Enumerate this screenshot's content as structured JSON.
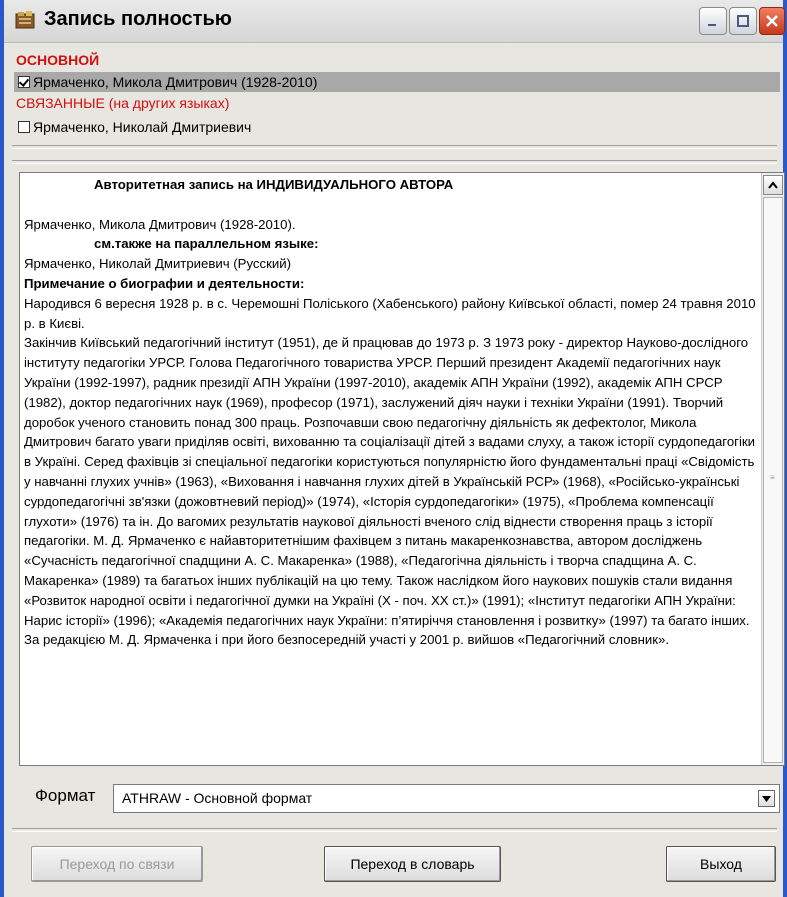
{
  "window": {
    "title": "Запись полностью",
    "controls": [
      "minimize-icon",
      "maximize-icon",
      "close-icon"
    ]
  },
  "main_heading": "ОСНОВНОЙ",
  "main_record": "Ярмаченко, Микола Дмитрович (1928-2010)",
  "related_heading": "СВЯЗАННЫЕ (на других языках)",
  "related_record": "Ярмаченко, Николай Дмитриевич",
  "record_text": {
    "title": "Авторитетная запись на ИНДИВИДУАЛЬНОГО АВТОРА",
    "name": "Ярмаченко, Микола Дмитрович (1928-2010).",
    "see_also": "см.также на параллельном языке:",
    "parallel": "Ярмаченко, Николай Дмитриевич (Русский)",
    "note_heading": "Примечание о биографии и деятельности:",
    "born": "Народився 6 вересня 1928 р. в с. Черемошні Поліського (Хабенського) району Київської області, помер  24 травня 2010 р. в Києві.",
    "bio": "Закінчив Київський педагогічний інститут (1951), де й працював до 1973 р. З 1973 року - директор Науково-дослідного інституту педагогіки УРСР. Голова Педагогічного товариства УРСР. Перший президент Академії педагогічних наук України (1992-1997), радник президії АПН України (1997-2010), академік АПН України (1992), академік АПН СРСР (1982), доктор педагогічних наук (1969), професор (1971), заслужений діяч науки і техніки України (1991). Творчий доробок ученого становить понад 300 праць. Розпочавши свою педагогічну діяльність як дефектолог, Микола Дмитрович багато уваги приділяв освіті, вихованню та соціалізації дітей з вадами слуху, а також історії сурдопедагогіки в Україні. Серед фахівців зі спеціальної педагогіки користуються популярністю його фундаментальні праці «Свідомість у навчанні глухих учнів» (1963), «Виховання і навчання глухих дітей в Українській РСР» (1968), «Російсько-українські сурдопедагогічні зв'язки (дожовтневий період)» (1974), «Історія сурдопедагогіки» (1975), «Проблема компенсації глухоти» (1976) та ін. До вагомих результатів наукової діяльності вченого слід віднести створення праць з історії педагогіки. М. Д. Ярмаченко є найавторитетнішим фахівцем з питань макаренкознавства, автором досліджень «Сучасність педагогічної спадщини А. С. Макаренка» (1988), «Педагогічна діяльність і творча спадщина А. С. Макаренка» (1989) та багатьох інших публікацій на цю тему. Також наслідком його наукових пошуків стали видання «Розвиток народної освіти і педагогічної думки на Україні (Х - поч. ХХ ст.)» (1991); «Інститут педагогіки АПН України: Нарис історії» (1996); «Академія педагогічних наук України: п’ятиріччя становлення і розвитку» (1997) та багато інших. За редакцією М. Д. Ярмаченка і при його безпосередній участі у 2001 р. вийшов «Педагогічний словник»."
  },
  "format": {
    "label": "Формат",
    "value": "ATHRAW - Основной формат"
  },
  "buttons": {
    "follow_link": "Переход по связи",
    "to_dictionary": "Переход в словарь",
    "exit": "Выход"
  }
}
